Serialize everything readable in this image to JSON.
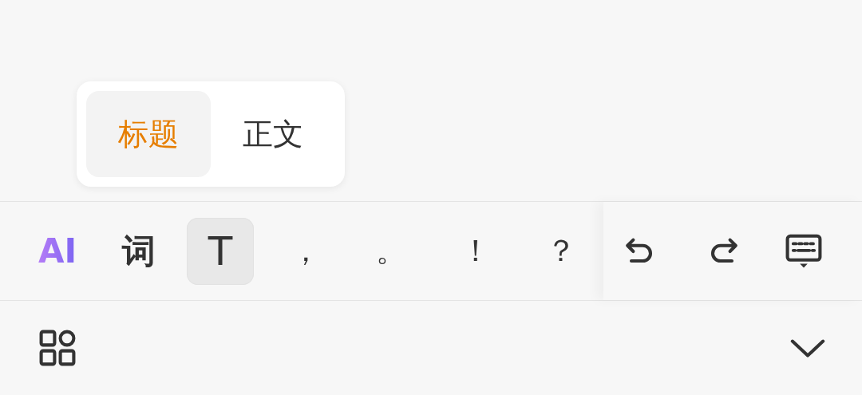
{
  "style_popup": {
    "options": [
      {
        "label": "标题",
        "selected": true
      },
      {
        "label": "正文",
        "selected": false
      }
    ]
  },
  "toolbar": {
    "tools": [
      {
        "kind": "ai",
        "label": "AI",
        "selected": false
      },
      {
        "kind": "word",
        "label": "词",
        "selected": false
      },
      {
        "kind": "format",
        "label": "T",
        "selected": true
      }
    ],
    "punctuation": [
      "，",
      "。",
      "！",
      "？"
    ],
    "actions": [
      {
        "kind": "undo"
      },
      {
        "kind": "redo"
      },
      {
        "kind": "keyboard-hide"
      }
    ]
  },
  "bottom_bar": [
    {
      "kind": "apps"
    },
    {
      "kind": "collapse"
    }
  ]
}
